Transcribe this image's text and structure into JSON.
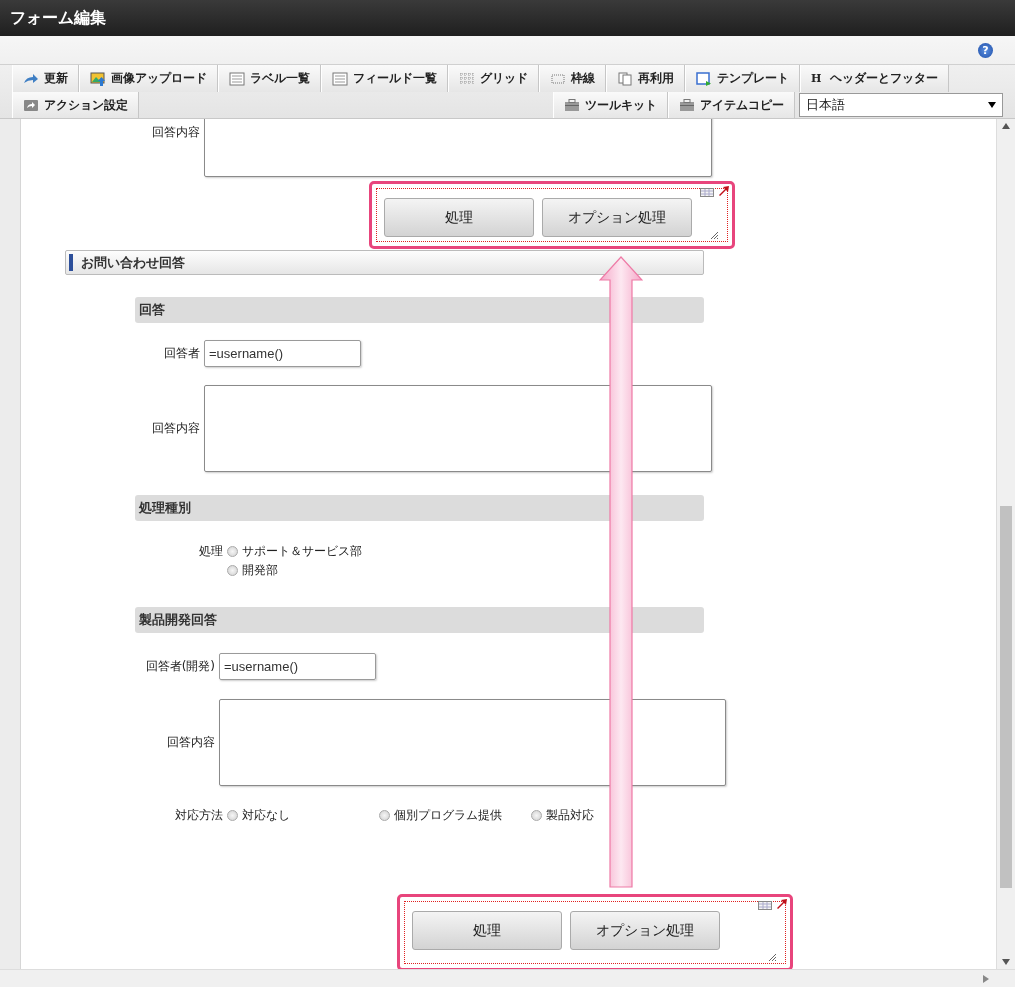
{
  "window": {
    "title": "フォーム編集"
  },
  "toolbar": {
    "help": "?",
    "tabs": [
      {
        "label": "更新"
      },
      {
        "label": "画像アップロード"
      },
      {
        "label": "ラベル一覧"
      },
      {
        "label": "フィールド一覧"
      },
      {
        "label": "グリッド"
      },
      {
        "label": "枠線"
      },
      {
        "label": "再利用"
      },
      {
        "label": "テンプレート"
      },
      {
        "label": "ヘッダーとフッター",
        "glyph": "H"
      }
    ],
    "row2_left": [
      {
        "label": "アクション設定"
      }
    ],
    "row2_right": [
      {
        "label": "ツールキット"
      },
      {
        "label": "アイテムコピー"
      }
    ],
    "language": "日本語"
  },
  "canvas": {
    "items": [
      {
        "kind": "textarea",
        "label": "回答内容"
      },
      {
        "kind": "buttons",
        "highlighted": true,
        "buttons": [
          "処理",
          "オプション処理"
        ]
      },
      {
        "kind": "section",
        "title": "お問い合わせ回答"
      },
      {
        "kind": "subsection",
        "title": "回答"
      },
      {
        "kind": "text",
        "label": "回答者",
        "value": "=username()"
      },
      {
        "kind": "textarea",
        "label": "回答内容"
      },
      {
        "kind": "subsection",
        "title": "処理種別"
      },
      {
        "kind": "radio_column",
        "label": "処理",
        "options": [
          {
            "label": "サポート＆サービス部",
            "selected": false
          },
          {
            "label": "開発部",
            "selected": false
          }
        ]
      },
      {
        "kind": "subsection",
        "title": "製品開発回答"
      },
      {
        "kind": "text",
        "label": "回答者(開発)",
        "value": "=username()"
      },
      {
        "kind": "textarea",
        "label": "回答内容"
      },
      {
        "kind": "radio_row",
        "label": "対応方法",
        "options": [
          {
            "label": "対応なし",
            "selected": false
          },
          {
            "label": "個別プログラム提供",
            "selected": false
          },
          {
            "label": "製品対応",
            "selected": false
          }
        ]
      },
      {
        "kind": "buttons",
        "highlighted": true,
        "buttons": [
          "処理",
          "オプション処理"
        ]
      }
    ]
  }
}
